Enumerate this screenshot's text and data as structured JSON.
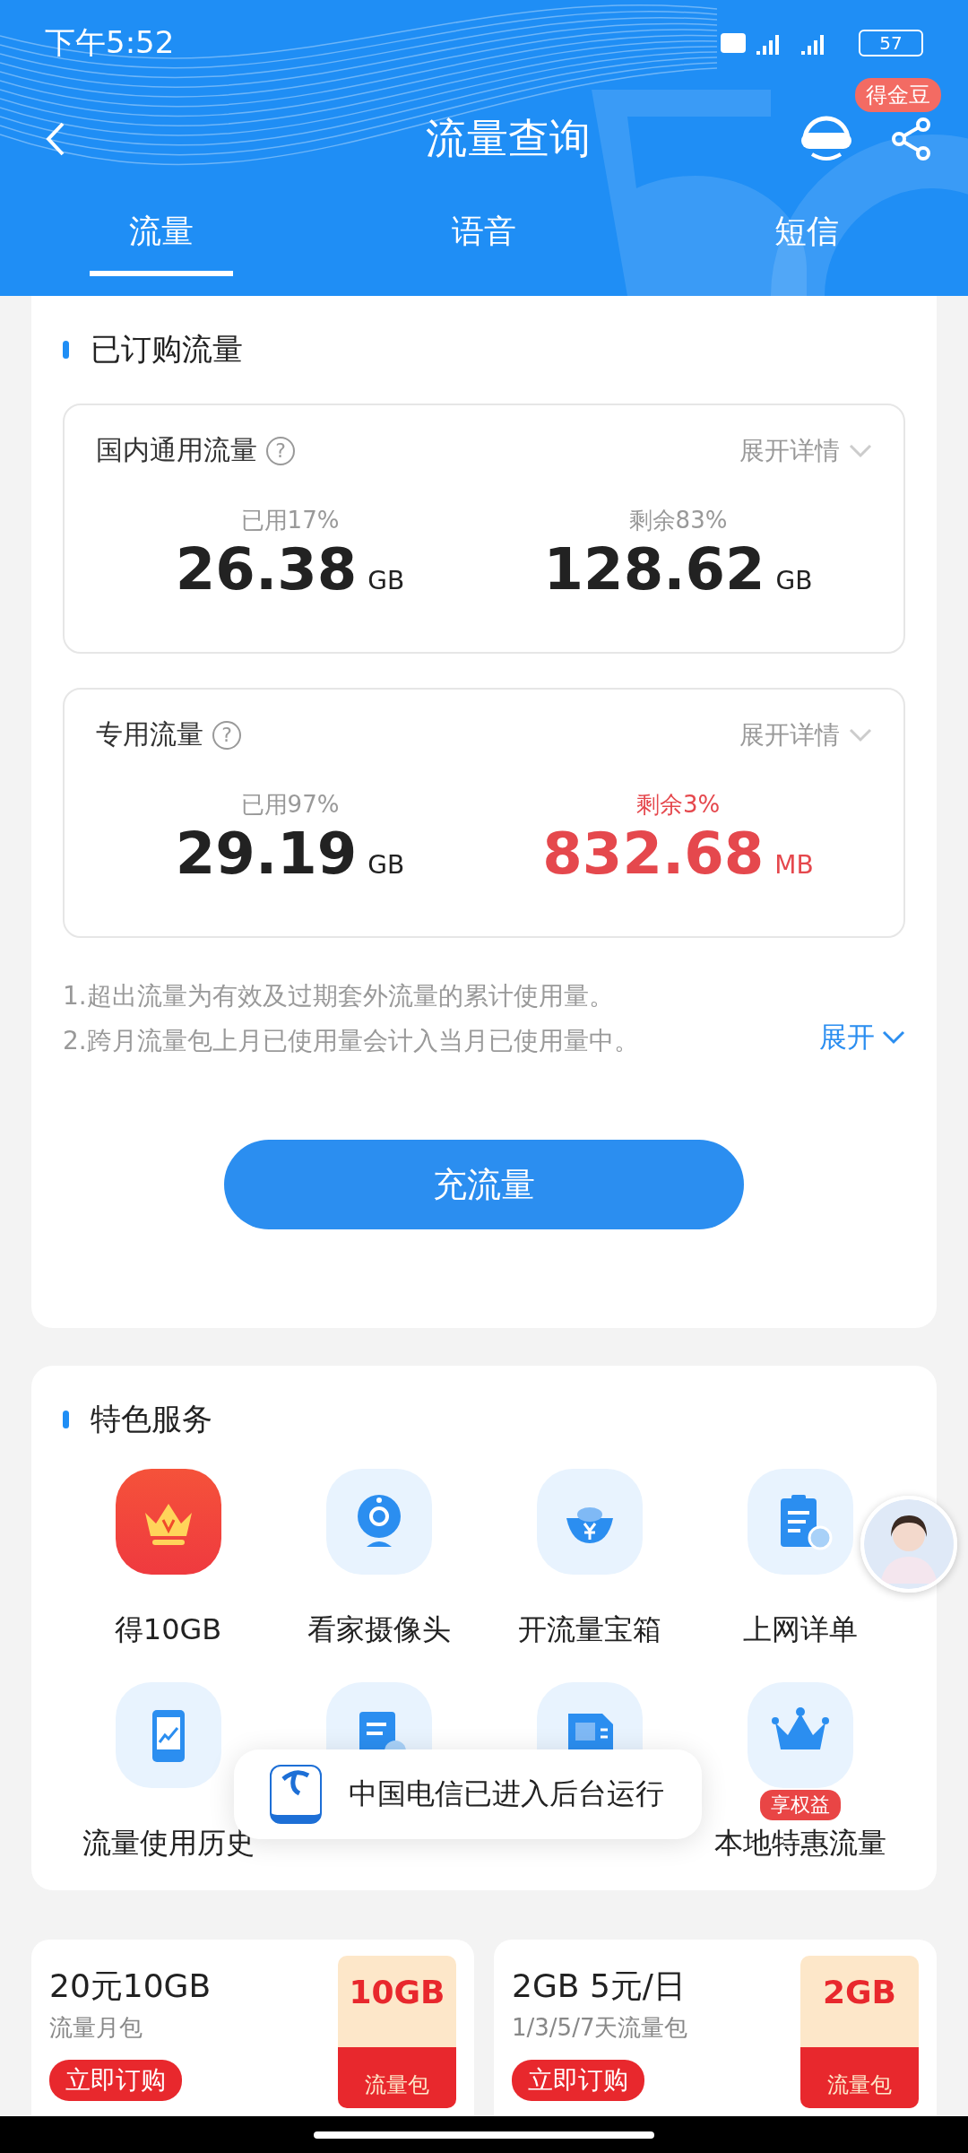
{
  "status_bar": {
    "time": "下午5:52",
    "battery": "57"
  },
  "header": {
    "title": "流量查询",
    "badge": "得金豆"
  },
  "tabs": [
    {
      "label": "流量",
      "selected": true
    },
    {
      "label": "语音",
      "selected": false
    },
    {
      "label": "短信",
      "selected": false
    }
  ],
  "subscribed": {
    "title": "已订购流量",
    "pools": [
      {
        "name": "国内通用流量",
        "help": "?",
        "expand_label": "展开详情",
        "used": {
          "label": "已用17%",
          "value": "26.38",
          "unit": "GB"
        },
        "remaining": {
          "label": "剩余83%",
          "value": "128.62",
          "unit": "GB",
          "warning": false
        }
      },
      {
        "name": "专用流量",
        "help": "?",
        "expand_label": "展开详情",
        "used": {
          "label": "已用97%",
          "value": "29.19",
          "unit": "GB"
        },
        "remaining": {
          "label": "剩余3%",
          "value": "832.68",
          "unit": "MB",
          "warning": true
        }
      }
    ],
    "notes": [
      "1.超出流量为有效及过期套外流量的累计使用量。",
      "2.跨月流量包上月已使用量会计入当月已使用量中。"
    ],
    "expand_label": "展开",
    "button": "充流量"
  },
  "services": {
    "title": "特色服务",
    "items": [
      {
        "label": "得10GB",
        "kind": "featured"
      },
      {
        "label": "看家摄像头",
        "kind": "camera"
      },
      {
        "label": "开流量宝箱",
        "kind": "ingot"
      },
      {
        "label": "上网详单",
        "kind": "list"
      },
      {
        "label": "流量使用历史",
        "kind": "phone"
      },
      {
        "kind": "document"
      },
      {
        "kind": "sim"
      },
      {
        "label": "本地特惠流量",
        "kind": "crown",
        "badge": "享权益"
      }
    ]
  },
  "toast": {
    "text": "中国电信已进入后台运行"
  },
  "offers": [
    {
      "title": "20元10GB",
      "subtitle": "流量月包",
      "button": "立即订购",
      "tag_value": "10GB",
      "tag_label": "流量包"
    },
    {
      "title": "2GB 5元/日",
      "subtitle": "1/3/5/7天流量包",
      "button": "立即订购",
      "tag_value": "2GB",
      "tag_label": "流量包"
    }
  ]
}
